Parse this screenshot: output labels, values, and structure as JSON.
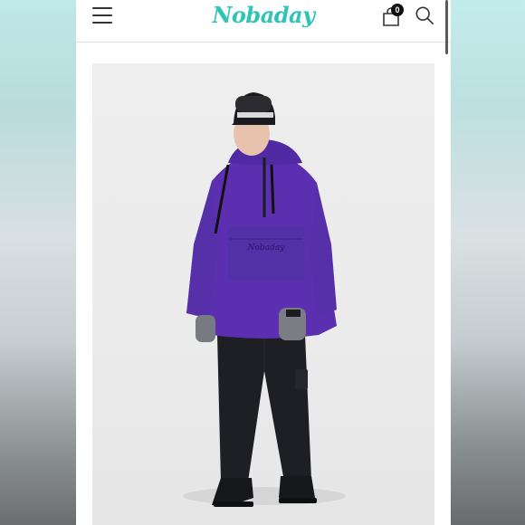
{
  "header": {
    "brand": "Nobaday",
    "cart_count": "0",
    "icons": {
      "menu": "hamburger-menu-icon",
      "cart": "shopping-bag-icon",
      "search": "search-icon"
    }
  },
  "product": {
    "image_description_colors": {
      "jacket": "#5b2fb0",
      "pants": "#1d1f24",
      "background": "#ececec"
    },
    "jacket_print": "Nobaday"
  },
  "colors": {
    "accent": "#2ec4b6",
    "badge": "#111111"
  }
}
